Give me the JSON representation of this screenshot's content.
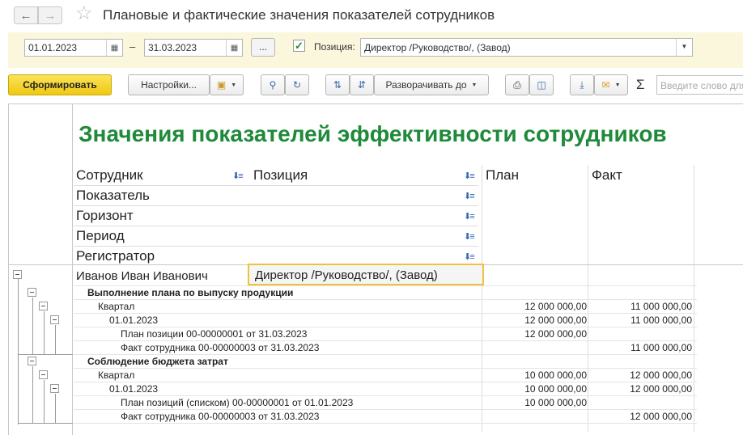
{
  "window": {
    "title": "Плановые и фактические значения показателей сотрудников"
  },
  "params": {
    "date_from": "01.01.2023",
    "date_separator": "–",
    "date_to": "31.03.2023",
    "dots_label": "...",
    "position_checked": true,
    "position_label": "Позиция:",
    "position_value": "Директор /Руководство/, (Завод)"
  },
  "toolbar": {
    "generate_label": "Сформировать",
    "settings_label": "Настройки...",
    "expand_label": "Разворачивать до",
    "sigma": "Σ",
    "search_placeholder": "Введите слово для поиска"
  },
  "report": {
    "title": "Значения показателей эффективности сотрудников",
    "headers": {
      "employee": "Сотрудник",
      "position": "Позиция",
      "plan": "План",
      "fact": "Факт",
      "indicator": "Показатель",
      "horizon": "Горизонт",
      "period": "Период",
      "registrar": "Регистратор"
    },
    "employee": {
      "name": "Иванов Иван Иванович",
      "position": "Директор /Руководство/, (Завод)"
    },
    "rows": [
      {
        "label": "Выполнение плана по выпуску продукции",
        "plan": "",
        "fact": ""
      },
      {
        "label": "Квартал",
        "plan": "12 000 000,00",
        "fact": "11 000 000,00"
      },
      {
        "label": "01.01.2023",
        "plan": "12 000 000,00",
        "fact": "11 000 000,00"
      },
      {
        "label": "План позиции 00-00000001 от 31.03.2023",
        "plan": "12 000 000,00",
        "fact": ""
      },
      {
        "label": "Факт сотрудника 00-00000003 от 31.03.2023",
        "plan": "",
        "fact": "11 000 000,00"
      },
      {
        "label": "Соблюдение бюджета затрат",
        "plan": "",
        "fact": ""
      },
      {
        "label": "Квартал",
        "plan": "10 000 000,00",
        "fact": "12 000 000,00"
      },
      {
        "label": "01.01.2023",
        "plan": "10 000 000,00",
        "fact": "12 000 000,00"
      },
      {
        "label": "План позиций (списком) 00-00000001 от 01.01.2023",
        "plan": "10 000 000,00",
        "fact": ""
      },
      {
        "label": "Факт сотрудника 00-00000003 от 31.03.2023",
        "plan": "",
        "fact": "12 000 000,00"
      }
    ]
  }
}
